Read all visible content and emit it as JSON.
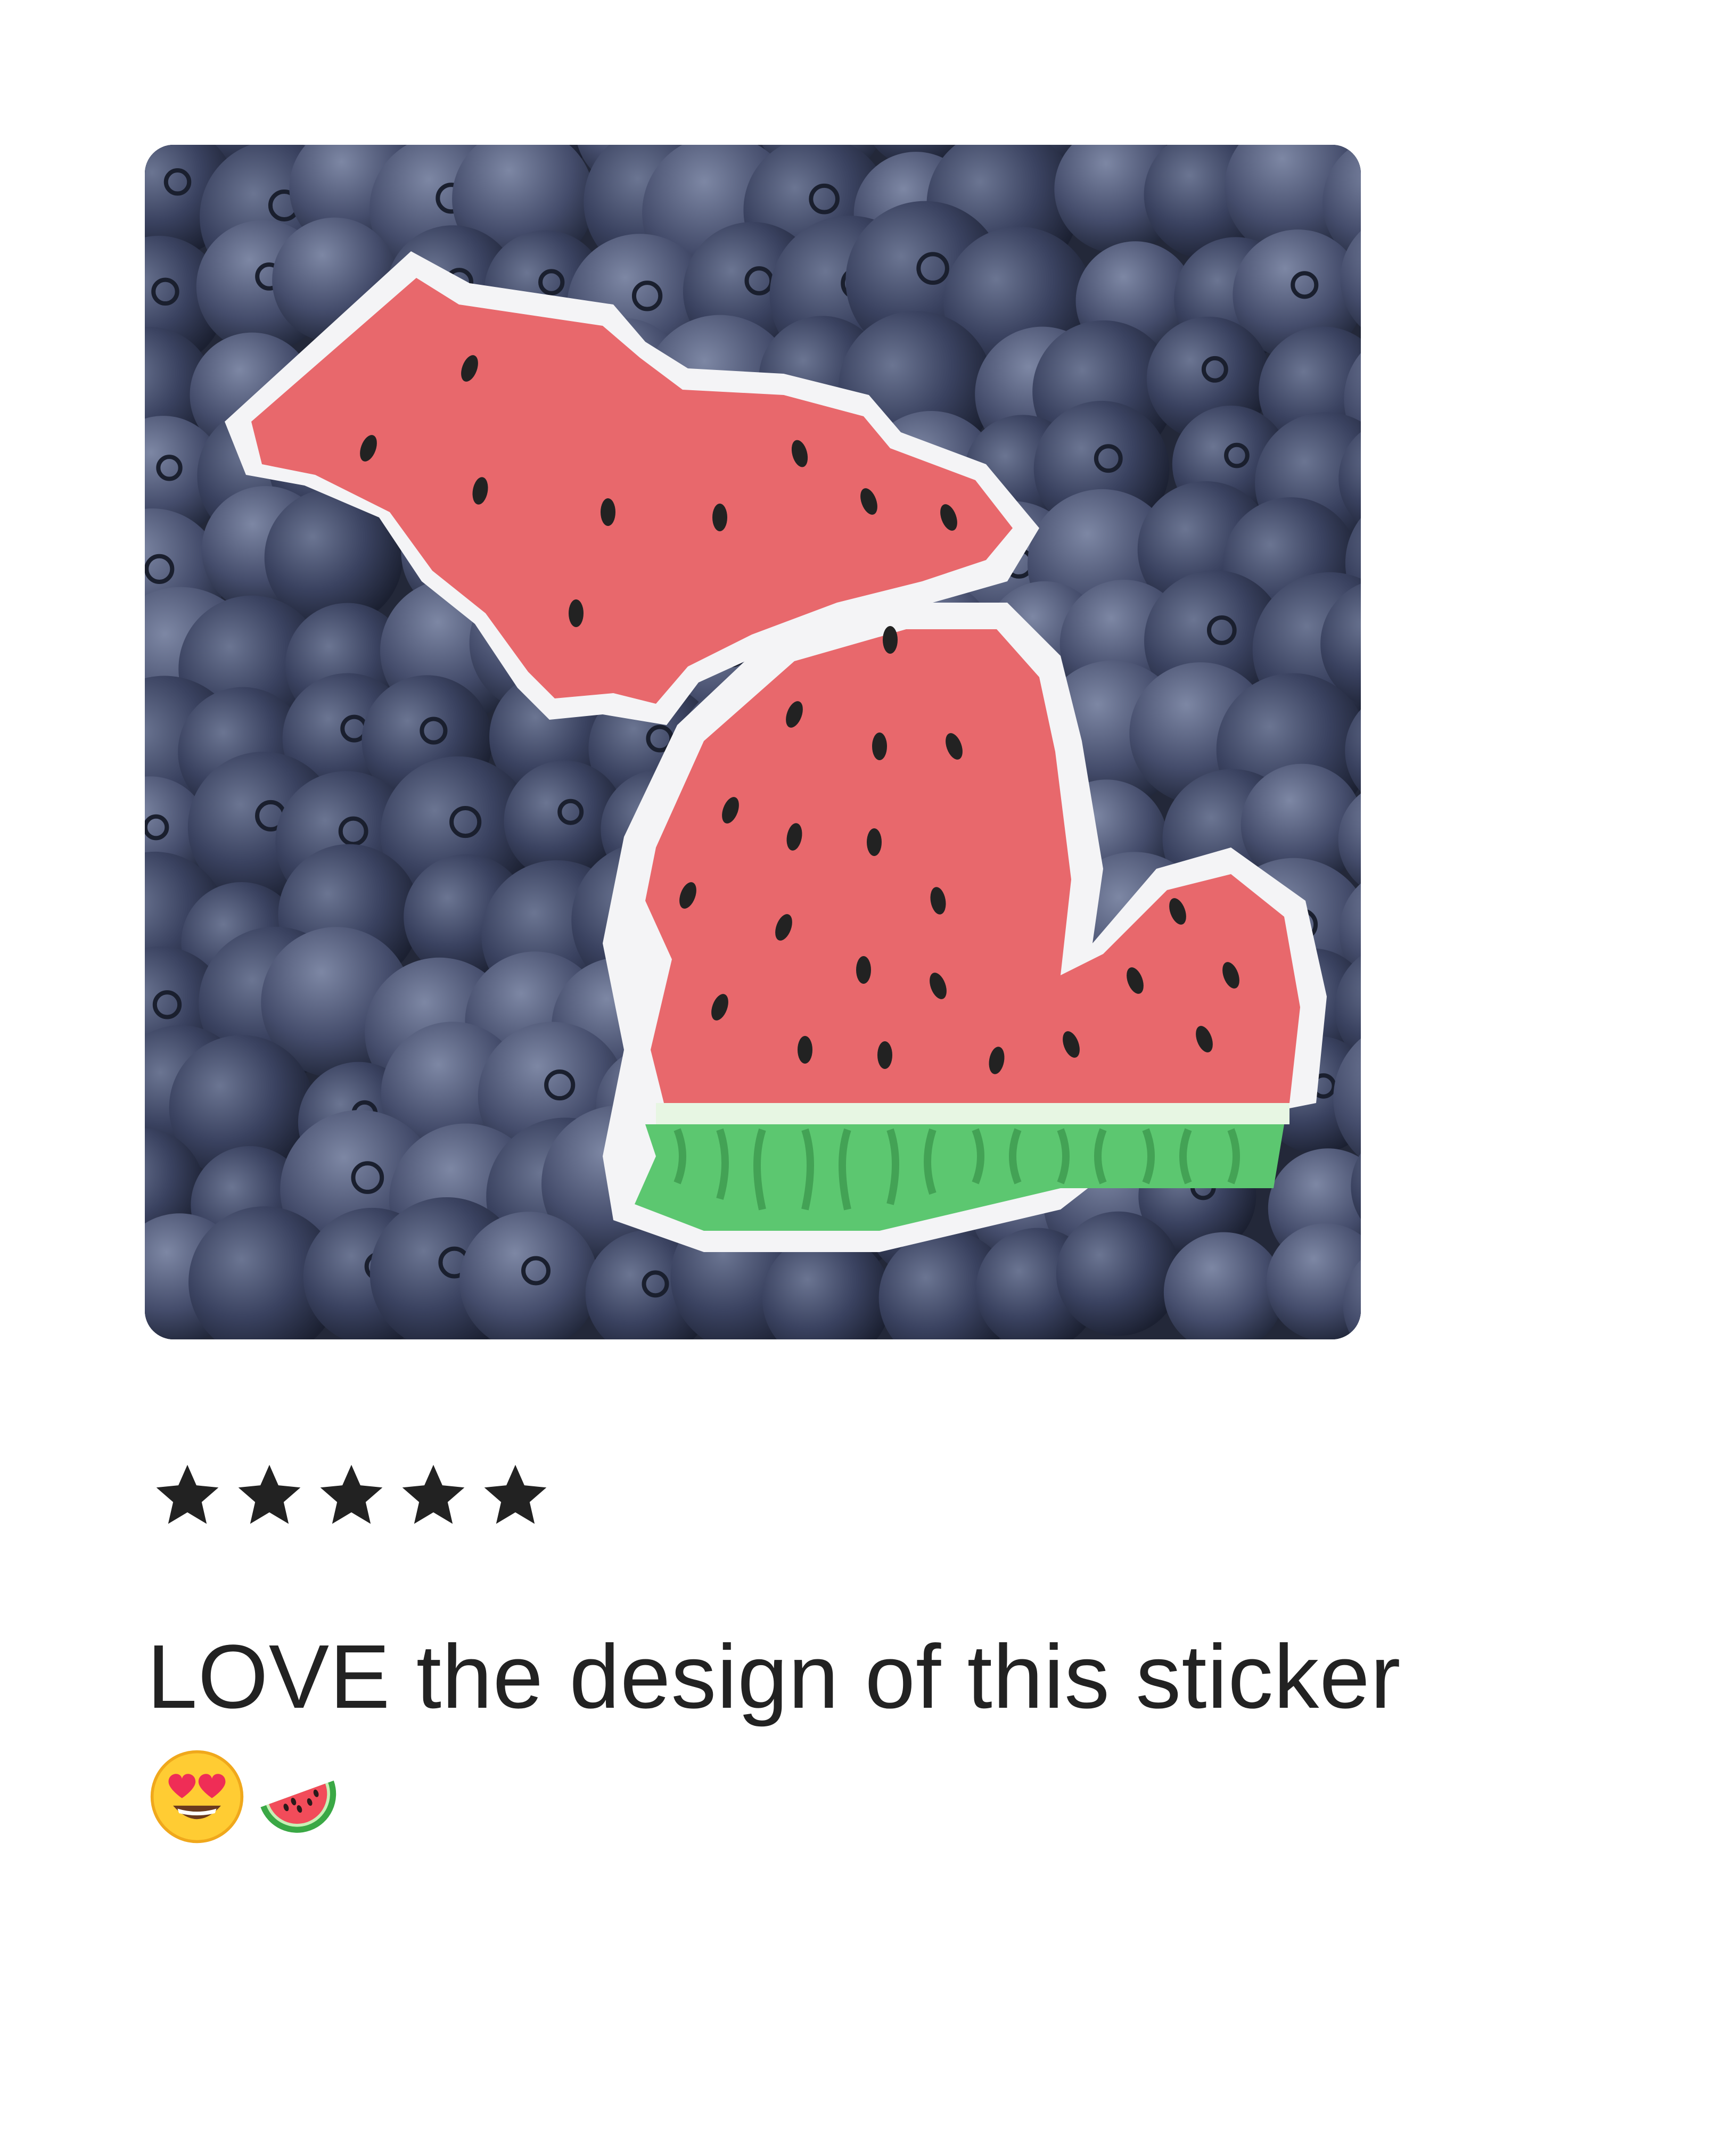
{
  "review": {
    "photo_alt": "Michigan-shaped watermelon sticker on blueberries",
    "rating": 5,
    "rating_max": 5,
    "text": "LOVE the design of this sticker",
    "emojis": [
      "heart-eyes-emoji",
      "watermelon-emoji"
    ]
  },
  "colors": {
    "star": "#222222",
    "text": "#222222",
    "watermelon_flesh": "#e8686c",
    "watermelon_rind": "#5cc770",
    "sticker_border": "#f4f4f6"
  }
}
